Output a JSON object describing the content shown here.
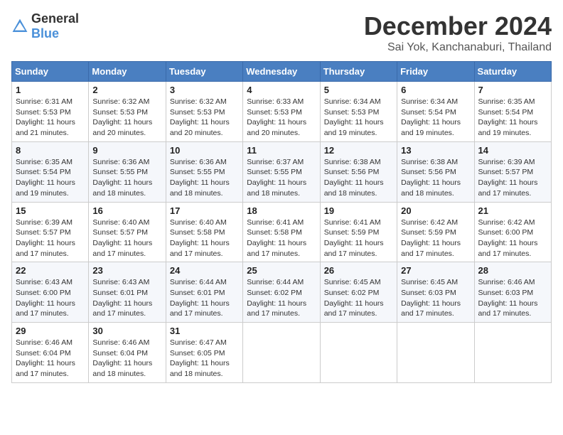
{
  "header": {
    "logo_general": "General",
    "logo_blue": "Blue",
    "month_title": "December 2024",
    "location": "Sai Yok, Kanchanaburi, Thailand"
  },
  "weekdays": [
    "Sunday",
    "Monday",
    "Tuesday",
    "Wednesday",
    "Thursday",
    "Friday",
    "Saturday"
  ],
  "weeks": [
    [
      {
        "day": "1",
        "sunrise": "6:31 AM",
        "sunset": "5:53 PM",
        "daylight": "11 hours and 21 minutes."
      },
      {
        "day": "2",
        "sunrise": "6:32 AM",
        "sunset": "5:53 PM",
        "daylight": "11 hours and 20 minutes."
      },
      {
        "day": "3",
        "sunrise": "6:32 AM",
        "sunset": "5:53 PM",
        "daylight": "11 hours and 20 minutes."
      },
      {
        "day": "4",
        "sunrise": "6:33 AM",
        "sunset": "5:53 PM",
        "daylight": "11 hours and 20 minutes."
      },
      {
        "day": "5",
        "sunrise": "6:34 AM",
        "sunset": "5:53 PM",
        "daylight": "11 hours and 19 minutes."
      },
      {
        "day": "6",
        "sunrise": "6:34 AM",
        "sunset": "5:54 PM",
        "daylight": "11 hours and 19 minutes."
      },
      {
        "day": "7",
        "sunrise": "6:35 AM",
        "sunset": "5:54 PM",
        "daylight": "11 hours and 19 minutes."
      }
    ],
    [
      {
        "day": "8",
        "sunrise": "6:35 AM",
        "sunset": "5:54 PM",
        "daylight": "11 hours and 19 minutes."
      },
      {
        "day": "9",
        "sunrise": "6:36 AM",
        "sunset": "5:55 PM",
        "daylight": "11 hours and 18 minutes."
      },
      {
        "day": "10",
        "sunrise": "6:36 AM",
        "sunset": "5:55 PM",
        "daylight": "11 hours and 18 minutes."
      },
      {
        "day": "11",
        "sunrise": "6:37 AM",
        "sunset": "5:55 PM",
        "daylight": "11 hours and 18 minutes."
      },
      {
        "day": "12",
        "sunrise": "6:38 AM",
        "sunset": "5:56 PM",
        "daylight": "11 hours and 18 minutes."
      },
      {
        "day": "13",
        "sunrise": "6:38 AM",
        "sunset": "5:56 PM",
        "daylight": "11 hours and 18 minutes."
      },
      {
        "day": "14",
        "sunrise": "6:39 AM",
        "sunset": "5:57 PM",
        "daylight": "11 hours and 17 minutes."
      }
    ],
    [
      {
        "day": "15",
        "sunrise": "6:39 AM",
        "sunset": "5:57 PM",
        "daylight": "11 hours and 17 minutes."
      },
      {
        "day": "16",
        "sunrise": "6:40 AM",
        "sunset": "5:57 PM",
        "daylight": "11 hours and 17 minutes."
      },
      {
        "day": "17",
        "sunrise": "6:40 AM",
        "sunset": "5:58 PM",
        "daylight": "11 hours and 17 minutes."
      },
      {
        "day": "18",
        "sunrise": "6:41 AM",
        "sunset": "5:58 PM",
        "daylight": "11 hours and 17 minutes."
      },
      {
        "day": "19",
        "sunrise": "6:41 AM",
        "sunset": "5:59 PM",
        "daylight": "11 hours and 17 minutes."
      },
      {
        "day": "20",
        "sunrise": "6:42 AM",
        "sunset": "5:59 PM",
        "daylight": "11 hours and 17 minutes."
      },
      {
        "day": "21",
        "sunrise": "6:42 AM",
        "sunset": "6:00 PM",
        "daylight": "11 hours and 17 minutes."
      }
    ],
    [
      {
        "day": "22",
        "sunrise": "6:43 AM",
        "sunset": "6:00 PM",
        "daylight": "11 hours and 17 minutes."
      },
      {
        "day": "23",
        "sunrise": "6:43 AM",
        "sunset": "6:01 PM",
        "daylight": "11 hours and 17 minutes."
      },
      {
        "day": "24",
        "sunrise": "6:44 AM",
        "sunset": "6:01 PM",
        "daylight": "11 hours and 17 minutes."
      },
      {
        "day": "25",
        "sunrise": "6:44 AM",
        "sunset": "6:02 PM",
        "daylight": "11 hours and 17 minutes."
      },
      {
        "day": "26",
        "sunrise": "6:45 AM",
        "sunset": "6:02 PM",
        "daylight": "11 hours and 17 minutes."
      },
      {
        "day": "27",
        "sunrise": "6:45 AM",
        "sunset": "6:03 PM",
        "daylight": "11 hours and 17 minutes."
      },
      {
        "day": "28",
        "sunrise": "6:46 AM",
        "sunset": "6:03 PM",
        "daylight": "11 hours and 17 minutes."
      }
    ],
    [
      {
        "day": "29",
        "sunrise": "6:46 AM",
        "sunset": "6:04 PM",
        "daylight": "11 hours and 17 minutes."
      },
      {
        "day": "30",
        "sunrise": "6:46 AM",
        "sunset": "6:04 PM",
        "daylight": "11 hours and 18 minutes."
      },
      {
        "day": "31",
        "sunrise": "6:47 AM",
        "sunset": "6:05 PM",
        "daylight": "11 hours and 18 minutes."
      },
      null,
      null,
      null,
      null
    ]
  ]
}
